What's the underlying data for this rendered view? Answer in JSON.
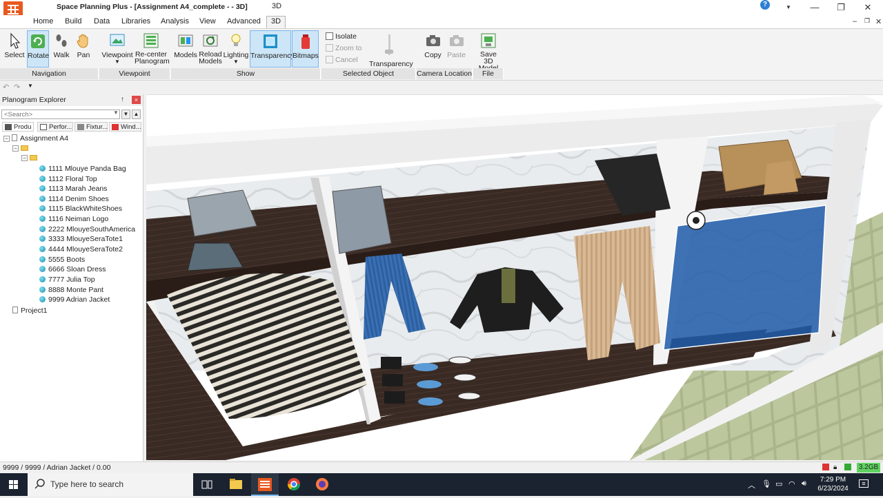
{
  "window": {
    "title": "Space Planning Plus - [Assignment A4_complete -  - 3D]",
    "view_caption": "3D",
    "help": "?"
  },
  "tabs": [
    "Home",
    "Build",
    "Data",
    "Libraries",
    "Analysis",
    "View",
    "Advanced",
    "3D"
  ],
  "active_tab": "3D",
  "ribbon": {
    "navigation": {
      "label": "Navigation",
      "buttons": [
        "Select",
        "Rotate",
        "Walk",
        "Pan"
      ]
    },
    "viewpoint": {
      "label": "Viewpoint",
      "viewpoint": "Viewpoint",
      "recenter_1": "Re-center",
      "recenter_2": "Planogram"
    },
    "show": {
      "label": "Show",
      "models": "Models",
      "reload_1": "Reload",
      "reload_2": "Models",
      "lighting": "Lighting",
      "transparency": "Transparency",
      "bitmaps": "Bitmaps"
    },
    "selected_object": {
      "label": "Selected Object",
      "isolate": "Isolate",
      "zoom_to": "Zoom to",
      "cancel": "Cancel",
      "transparency": "Transparency"
    },
    "camera_location": {
      "label": "Camera Location",
      "copy": "Copy",
      "paste": "Paste"
    },
    "file": {
      "label": "File",
      "save_1": "Save 3D",
      "save_2": "Model"
    }
  },
  "explorer": {
    "title": "Planogram Explorer",
    "pin": "↑",
    "close": "×",
    "search_placeholder": "<Search>",
    "tabs": [
      "Produ",
      "Perfor...",
      "Fixtur...",
      "Wind..."
    ],
    "root": "Assignment A4",
    "products": [
      "1111 Mlouye Panda Bag",
      "1112 Floral Top",
      "1113 Marah Jeans",
      "1114 Denim Shoes",
      "1115 BlackWhiteShoes",
      "1116 Neiman Logo",
      "2222 MlouyeSouthAmerica",
      "3333 MlouyeSeraTote1",
      "4444 MlouyeSeraTote2",
      "5555 Boots",
      "6666 Sloan Dress",
      "7777 Julia Top",
      "8888 Monte Pant",
      "9999 Adrian Jacket"
    ],
    "project": "Project1"
  },
  "status": {
    "text": "9999 / 9999 / Adrian Jacket / 0.00",
    "memory": "3.2GB"
  },
  "taskbar": {
    "search_placeholder": "Type here to search",
    "time": "7:29 PM",
    "date": "6/23/2024"
  }
}
